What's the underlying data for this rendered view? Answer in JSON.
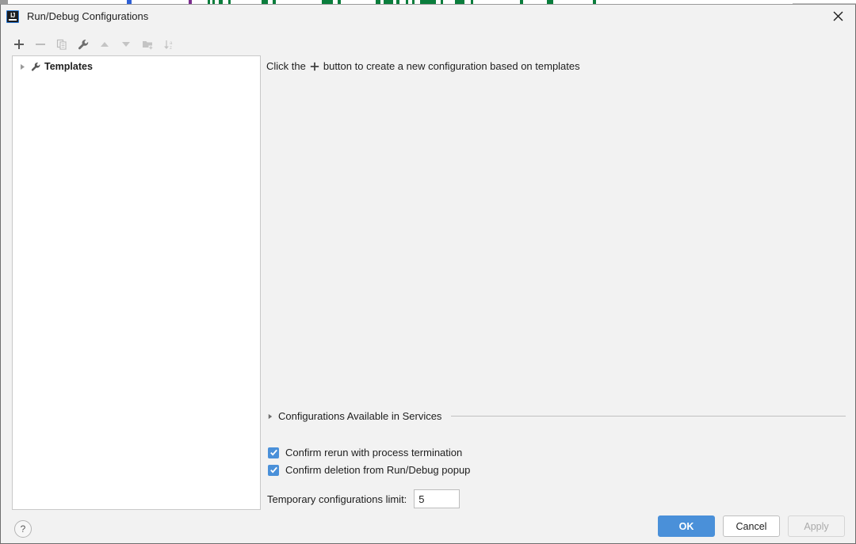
{
  "window": {
    "title": "Run/Debug Configurations",
    "app_icon": "intellij-idea-icon",
    "close_icon": "close-icon"
  },
  "toolbar": {
    "items": [
      {
        "icon": "plus-icon",
        "label": "Add New Configuration",
        "enabled": true
      },
      {
        "icon": "minus-icon",
        "label": "Remove Configuration",
        "enabled": false
      },
      {
        "icon": "copy-icon",
        "label": "Copy Configuration",
        "enabled": false
      },
      {
        "icon": "wrench-icon",
        "label": "Edit Templates",
        "enabled": true
      },
      {
        "icon": "arrow-up-icon",
        "label": "Move Up",
        "enabled": false
      },
      {
        "icon": "arrow-down-icon",
        "label": "Move Down",
        "enabled": false
      },
      {
        "icon": "new-folder-icon",
        "label": "Create New Folder",
        "enabled": false
      },
      {
        "icon": "sort-az-icon",
        "label": "Sort Configurations",
        "enabled": false
      }
    ]
  },
  "tree": {
    "nodes": [
      {
        "label": "Templates",
        "icon": "wrench-icon",
        "arrow": "chevron-right-icon",
        "expanded": false
      }
    ]
  },
  "main": {
    "hint_prefix": "Click the",
    "hint_icon": "plus-icon",
    "hint_suffix": "button to create a new configuration based on templates"
  },
  "services": {
    "arrow": "chevron-right-icon",
    "label": "Configurations Available in Services",
    "expanded": false
  },
  "options": {
    "confirm_rerun": {
      "label": "Confirm rerun with process termination",
      "checked": true
    },
    "confirm_delete": {
      "label": "Confirm deletion from Run/Debug popup",
      "checked": true
    },
    "temp_limit": {
      "label": "Temporary configurations limit:",
      "value": "5"
    }
  },
  "footer": {
    "help_label": "?",
    "ok_label": "OK",
    "cancel_label": "Cancel",
    "apply_label": "Apply"
  },
  "colors": {
    "accent": "#4a90d9",
    "dialog_bg": "#f2f2f2",
    "panel_bg": "#ffffff",
    "text": "#1e1e1e",
    "disabled_text": "#aaaaaa"
  }
}
